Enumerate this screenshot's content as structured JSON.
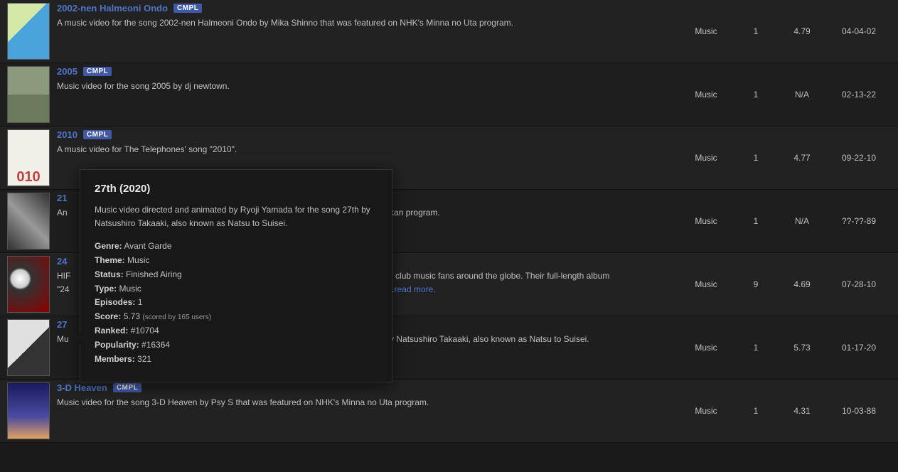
{
  "badge_label": "CMPL",
  "readmore_label": "read more.",
  "rows": [
    {
      "title": "2002-nen Halmeoni Ondo",
      "desc": "A music video for the song 2002-nen Halmeoni Ondo by Mika Shinno that was featured on NHK's Minna no Uta program.",
      "type": "Music",
      "eps": "1",
      "score": "4.79",
      "date": "04-04-02"
    },
    {
      "title": "2005",
      "desc": "Music video for the song 2005 by dj newtown.",
      "type": "Music",
      "eps": "1",
      "score": "N/A",
      "date": "02-13-22"
    },
    {
      "title": "2010",
      "desc": "A music video for The Telephones' song \"2010\".",
      "type": "Music",
      "eps": "1",
      "score": "4.77",
      "date": "09-22-10"
    },
    {
      "title": "21",
      "desc_pre": "An",
      "desc_post": "ukan program.",
      "type": "Music",
      "eps": "1",
      "score": "N/A",
      "date": "??-??-89"
    },
    {
      "title": "24",
      "desc_pre": "HIF",
      "desc_mid": "d club music fans around the globe. Their full-length album",
      "desc_line2_pre": "\"24",
      "desc_line2_post": ":…",
      "type": "Music",
      "eps": "9",
      "score": "4.69",
      "date": "07-28-10"
    },
    {
      "title": "27",
      "desc_pre": "Mu",
      "desc_post": " by Natsushiro Takaaki, also known as Natsu to Suisei.",
      "type": "Music",
      "eps": "1",
      "score": "5.73",
      "date": "01-17-20"
    },
    {
      "title": "3-D Heaven",
      "desc": "Music video for the song 3-D Heaven by Psy S that was featured on NHK's Minna no Uta program.",
      "type": "Music",
      "eps": "1",
      "score": "4.31",
      "date": "10-03-88"
    }
  ],
  "tooltip": {
    "title": "27th (2020)",
    "description": "Music video directed and animated by Ryoji Yamada for the song 27th by Natsushiro Takaaki, also known as Natsu to Suisei.",
    "fields": {
      "genre_label": "Genre:",
      "genre": "Avant Garde",
      "theme_label": "Theme:",
      "theme": "Music",
      "status_label": "Status:",
      "status": "Finished Airing",
      "type_label": "Type:",
      "type": "Music",
      "episodes_label": "Episodes:",
      "episodes": "1",
      "score_label": "Score:",
      "score": "5.73",
      "score_sub": "(scored by 165 users)",
      "ranked_label": "Ranked:",
      "ranked": "#10704",
      "popularity_label": "Popularity:",
      "popularity": "#16364",
      "members_label": "Members:",
      "members": "321"
    }
  }
}
